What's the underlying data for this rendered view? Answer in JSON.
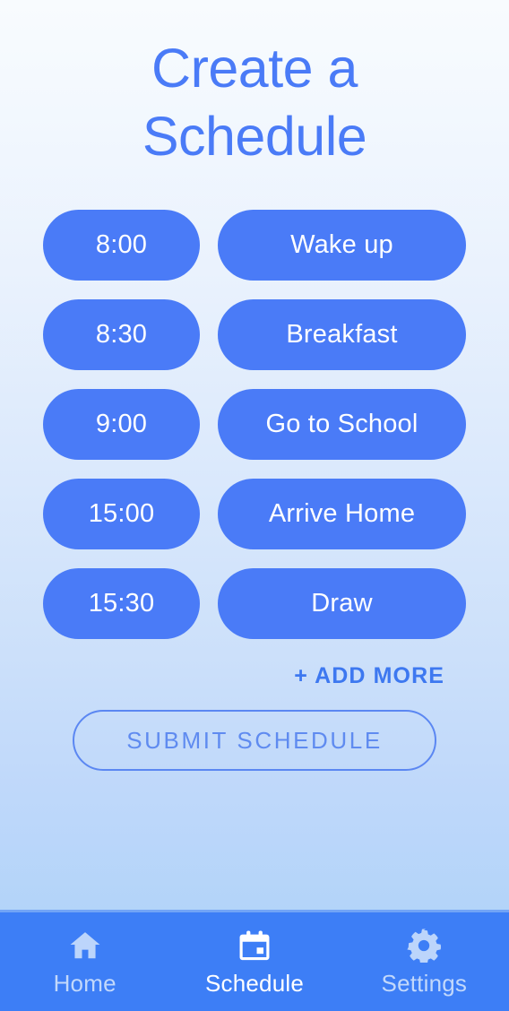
{
  "header": {
    "title": "Create a\nSchedule",
    "title_color": "#4a7bf7"
  },
  "schedule": {
    "rows": [
      {
        "time": "8:00",
        "activity": "Wake up"
      },
      {
        "time": "8:30",
        "activity": "Breakfast"
      },
      {
        "time": "9:00",
        "activity": "Go to School"
      },
      {
        "time": "15:00",
        "activity": "Arrive Home"
      },
      {
        "time": "15:30",
        "activity": "Draw"
      }
    ],
    "pill_color": "#4a7bf7",
    "pill_text_color": "#ffffff"
  },
  "actions": {
    "add_more_label": "+ ADD MORE",
    "add_more_color": "#3d78f0",
    "submit_label": "SUBMIT SCHEDULE",
    "submit_color": "#5f8bf0"
  },
  "bottom_nav": {
    "background_color": "#3d7ef6",
    "active_color": "#ffffff",
    "inactive_color": "#c2d8fb",
    "items": [
      {
        "label": "Home",
        "icon": "home-icon",
        "active": false
      },
      {
        "label": "Schedule",
        "icon": "calendar-icon",
        "active": true
      },
      {
        "label": "Settings",
        "icon": "gear-icon",
        "active": false
      }
    ]
  }
}
